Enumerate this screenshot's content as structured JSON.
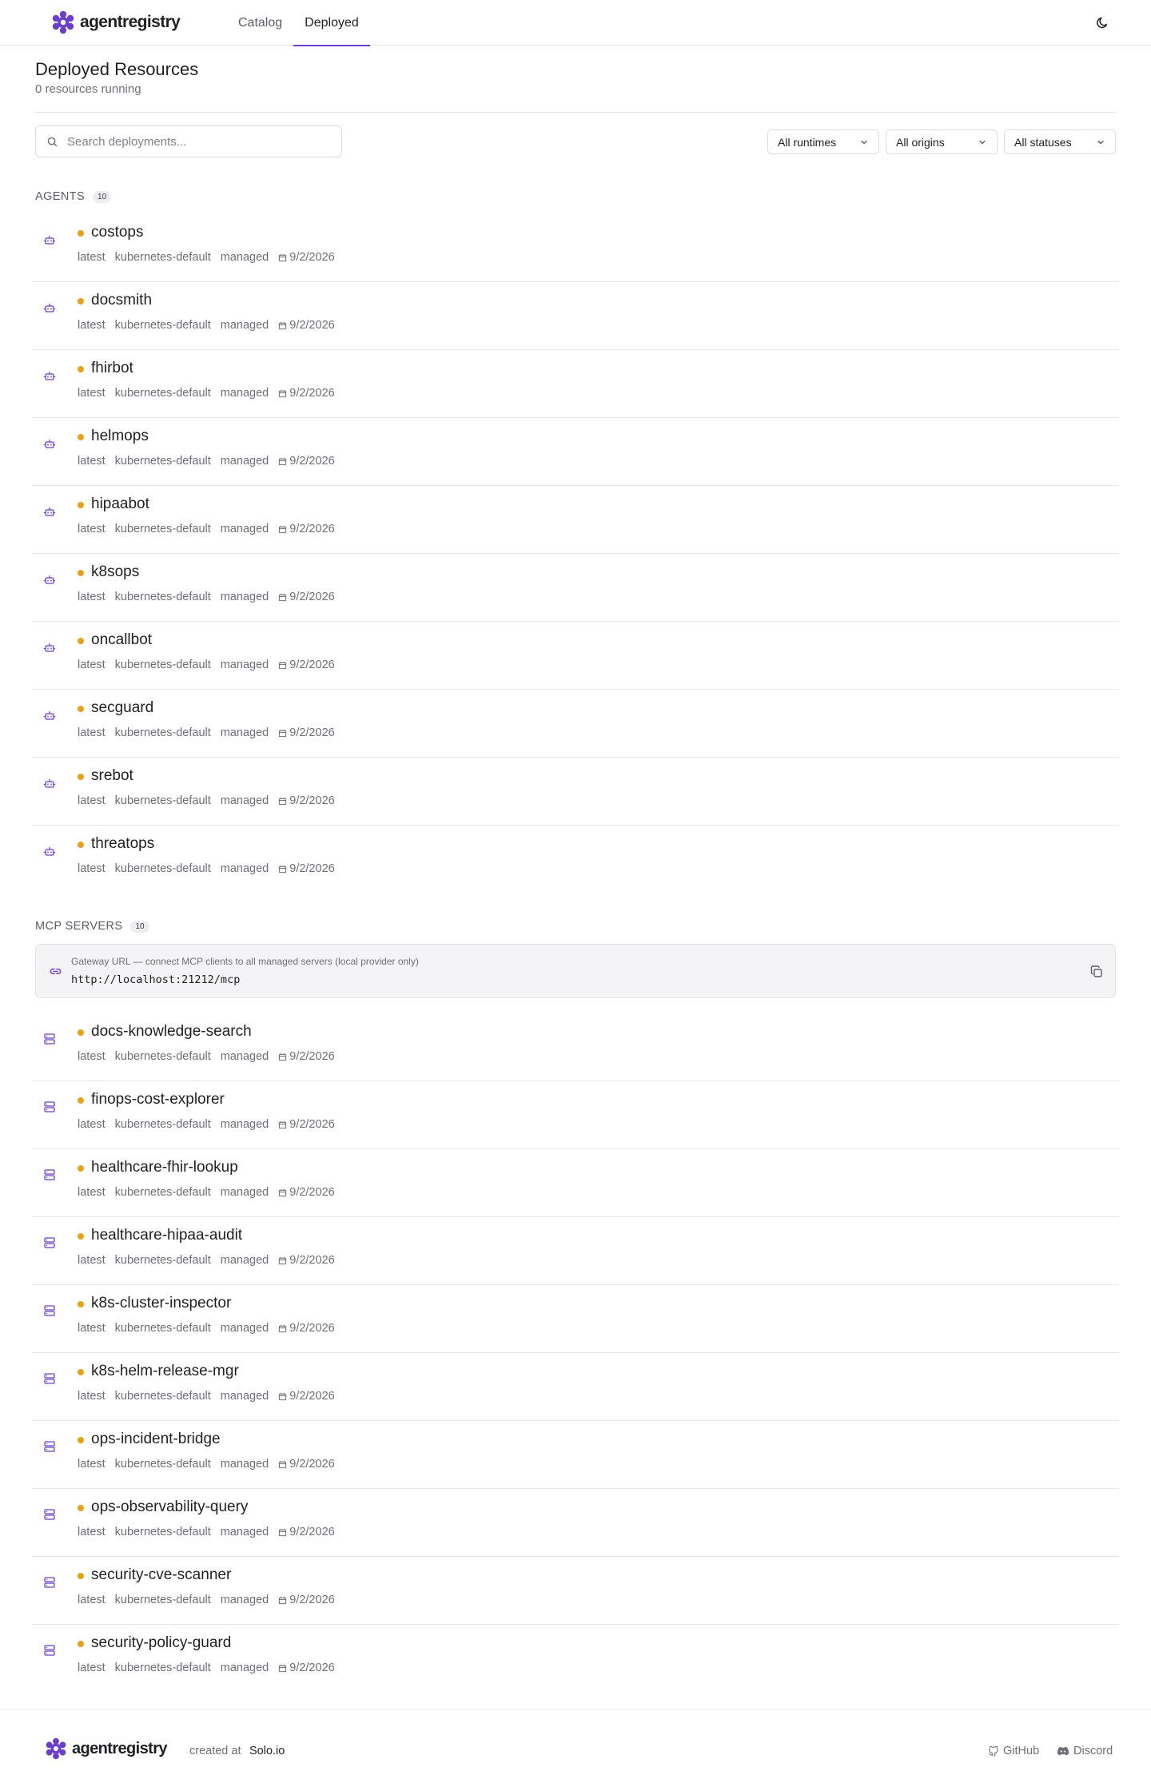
{
  "brand": {
    "name": "agentregistry",
    "color": "#6b3fc9"
  },
  "nav": {
    "tabs": [
      {
        "label": "Catalog",
        "active": false
      },
      {
        "label": "Deployed",
        "active": true
      }
    ]
  },
  "page": {
    "title": "Deployed Resources",
    "subtitle": "0 resources running"
  },
  "toolbar": {
    "search_placeholder": "Search deployments...",
    "filters": {
      "runtime": "All runtimes",
      "origin": "All origins",
      "status": "All statuses"
    }
  },
  "agents": {
    "label": "AGENTS",
    "count": "10",
    "items": [
      {
        "name": "costops",
        "version": "latest",
        "provider": "kubernetes-default",
        "origin": "managed",
        "date": "9/2/2026"
      },
      {
        "name": "docsmith",
        "version": "latest",
        "provider": "kubernetes-default",
        "origin": "managed",
        "date": "9/2/2026"
      },
      {
        "name": "fhirbot",
        "version": "latest",
        "provider": "kubernetes-default",
        "origin": "managed",
        "date": "9/2/2026"
      },
      {
        "name": "helmops",
        "version": "latest",
        "provider": "kubernetes-default",
        "origin": "managed",
        "date": "9/2/2026"
      },
      {
        "name": "hipaabot",
        "version": "latest",
        "provider": "kubernetes-default",
        "origin": "managed",
        "date": "9/2/2026"
      },
      {
        "name": "k8sops",
        "version": "latest",
        "provider": "kubernetes-default",
        "origin": "managed",
        "date": "9/2/2026"
      },
      {
        "name": "oncallbot",
        "version": "latest",
        "provider": "kubernetes-default",
        "origin": "managed",
        "date": "9/2/2026"
      },
      {
        "name": "secguard",
        "version": "latest",
        "provider": "kubernetes-default",
        "origin": "managed",
        "date": "9/2/2026"
      },
      {
        "name": "srebot",
        "version": "latest",
        "provider": "kubernetes-default",
        "origin": "managed",
        "date": "9/2/2026"
      },
      {
        "name": "threatops",
        "version": "latest",
        "provider": "kubernetes-default",
        "origin": "managed",
        "date": "9/2/2026"
      }
    ]
  },
  "mcp": {
    "label": "MCP SERVERS",
    "count": "10",
    "gateway": {
      "label": "Gateway URL — connect MCP clients to all managed servers (local provider only)",
      "url": "http://localhost:21212/mcp"
    },
    "items": [
      {
        "name": "docs-knowledge-search",
        "version": "latest",
        "provider": "kubernetes-default",
        "origin": "managed",
        "date": "9/2/2026"
      },
      {
        "name": "finops-cost-explorer",
        "version": "latest",
        "provider": "kubernetes-default",
        "origin": "managed",
        "date": "9/2/2026"
      },
      {
        "name": "healthcare-fhir-lookup",
        "version": "latest",
        "provider": "kubernetes-default",
        "origin": "managed",
        "date": "9/2/2026"
      },
      {
        "name": "healthcare-hipaa-audit",
        "version": "latest",
        "provider": "kubernetes-default",
        "origin": "managed",
        "date": "9/2/2026"
      },
      {
        "name": "k8s-cluster-inspector",
        "version": "latest",
        "provider": "kubernetes-default",
        "origin": "managed",
        "date": "9/2/2026"
      },
      {
        "name": "k8s-helm-release-mgr",
        "version": "latest",
        "provider": "kubernetes-default",
        "origin": "managed",
        "date": "9/2/2026"
      },
      {
        "name": "ops-incident-bridge",
        "version": "latest",
        "provider": "kubernetes-default",
        "origin": "managed",
        "date": "9/2/2026"
      },
      {
        "name": "ops-observability-query",
        "version": "latest",
        "provider": "kubernetes-default",
        "origin": "managed",
        "date": "9/2/2026"
      },
      {
        "name": "security-cve-scanner",
        "version": "latest",
        "provider": "kubernetes-default",
        "origin": "managed",
        "date": "9/2/2026"
      },
      {
        "name": "security-policy-guard",
        "version": "latest",
        "provider": "kubernetes-default",
        "origin": "managed",
        "date": "9/2/2026"
      }
    ]
  },
  "status_color": "#e8a21a",
  "icons": {
    "agent": "bot-icon",
    "mcp": "server-icon",
    "date": "calendar-icon",
    "theme": "moon-icon",
    "gateway": "link-icon",
    "copy": "copy-icon",
    "github": "github-icon",
    "discord": "discord-icon"
  },
  "footer": {
    "brand": "agentregistry",
    "created_at": "created at",
    "company": "Solo.io",
    "github": "GitHub",
    "discord": "Discord"
  }
}
